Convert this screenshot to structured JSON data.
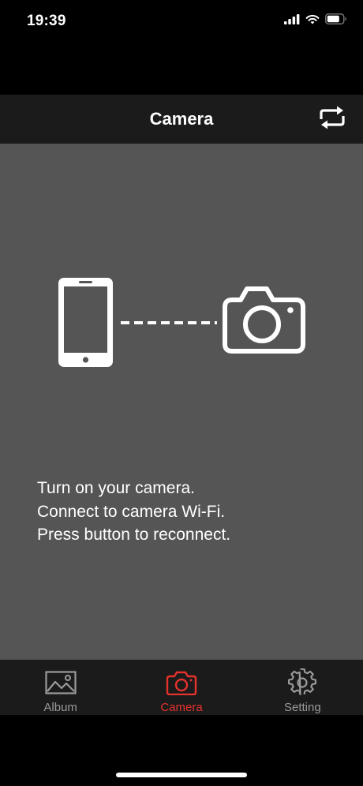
{
  "status_bar": {
    "time": "19:39"
  },
  "nav": {
    "title": "Camera",
    "refresh_icon": "refresh-icon"
  },
  "content": {
    "instructions": [
      "Turn on your camera.",
      "Connect to camera Wi-Fi.",
      "Press button to reconnect."
    ]
  },
  "tabs": [
    {
      "label": "Album",
      "icon": "image-icon",
      "active": false
    },
    {
      "label": "Camera",
      "icon": "camera-icon",
      "active": true
    },
    {
      "label": "Setting",
      "icon": "gear-icon",
      "active": false
    }
  ],
  "colors": {
    "accent": "#e5322d",
    "content_bg": "#555555",
    "bar_bg": "#1b1b1b",
    "inactive_tab": "#9a9a9a"
  }
}
